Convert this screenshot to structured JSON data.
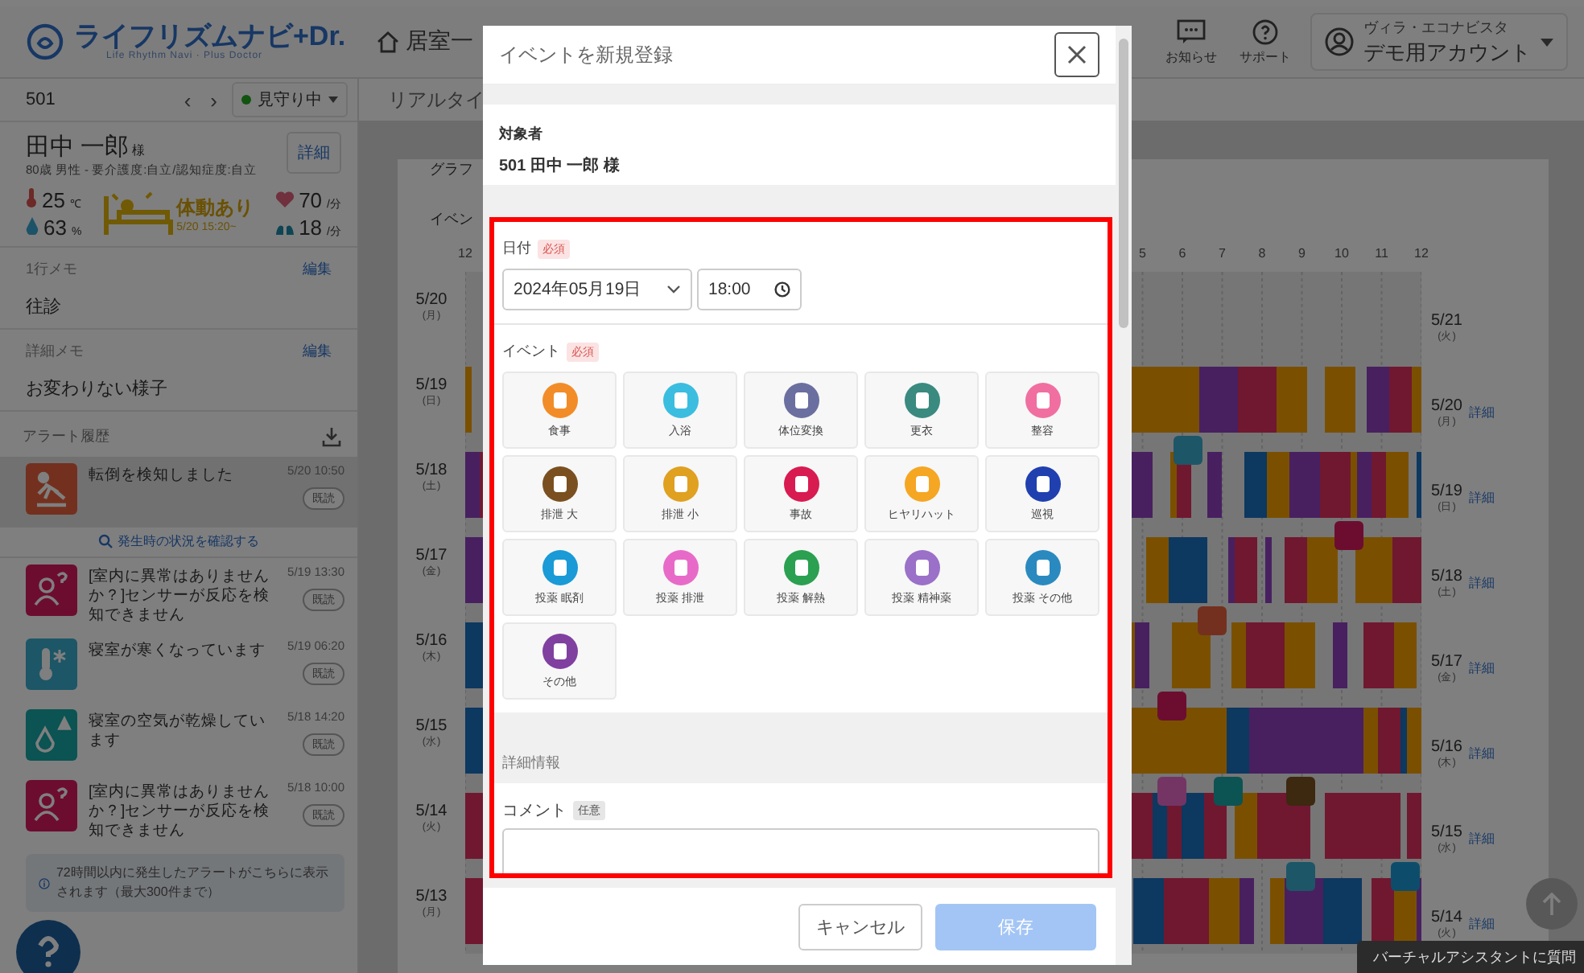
{
  "header": {
    "logo": "ライフリズムナビ+Dr.",
    "tagline": "Life Rhythm Navi · Plus Doctor",
    "nav": "居室一",
    "notifications": "お知らせ",
    "support": "サポート",
    "account": {
      "facility": "ヴィラ・エコナビスタ",
      "name": "デモ用アカウント"
    }
  },
  "resident_bar": {
    "room": "501",
    "prev": "‹",
    "next": "›",
    "status": "見守り中"
  },
  "resident": {
    "name": "田中 一郎",
    "honorific": "様",
    "profile": "80歳 男性 - 要介護度:自立/認知症度:自立",
    "detail_button": "詳細",
    "temperature": "25",
    "temperature_unit": "℃",
    "humidity": "63",
    "humidity_unit": "%",
    "activity": "体動あり",
    "activity_since": "5/20 15:20~",
    "heart_rate": "70",
    "heart_rate_unit": "/分",
    "respiration": "18",
    "respiration_unit": "/分"
  },
  "memos": [
    {
      "label": "1行メモ",
      "edit": "編集",
      "text": "往診"
    },
    {
      "label": "詳細メモ",
      "edit": "編集",
      "text": "お変わりない様子"
    }
  ],
  "alerts": {
    "title": "アラート履歴",
    "items": [
      {
        "kind": "fall",
        "text": "転倒を検知しました",
        "time": "5/20 10:50",
        "read": "既読",
        "selected": true,
        "link": "発生時の状況を確認する"
      },
      {
        "kind": "absence",
        "text": "[室内に異常はありませんか？]センサーが反応を検知できません",
        "time": "5/19 13:30",
        "read": "既読",
        "selected": false
      },
      {
        "kind": "cold",
        "text": "寝室が寒くなっています",
        "time": "5/19 06:20",
        "read": "既読",
        "selected": false
      },
      {
        "kind": "dry",
        "text": "寝室の空気が乾燥しています",
        "time": "5/18 14:20",
        "read": "既読",
        "selected": false
      },
      {
        "kind": "absence",
        "text": "[室内に異常はありませんか？]センサーが反応を検知できません",
        "time": "5/18 10:00",
        "read": "既読",
        "selected": false
      }
    ],
    "info": "72時間以内に発生したアラートがこちらに表示されます（最大300件まで）"
  },
  "main": {
    "tab": "リアルタイ",
    "graph_label": "グラフ",
    "event_label": "イベン",
    "ticks": [
      "12",
      "5",
      "6",
      "7",
      "8",
      "9",
      "10",
      "11",
      "12"
    ],
    "left_dates": [
      {
        "date": "5/20",
        "weekday": "(月)"
      },
      {
        "date": "5/19",
        "weekday": "(日)"
      },
      {
        "date": "5/18",
        "weekday": "(土)"
      },
      {
        "date": "5/17",
        "weekday": "(金)"
      },
      {
        "date": "5/16",
        "weekday": "(木)"
      },
      {
        "date": "5/15",
        "weekday": "(水)"
      },
      {
        "date": "5/14",
        "weekday": "(火)"
      },
      {
        "date": "5/13",
        "weekday": "(月)"
      }
    ],
    "right_dates": [
      {
        "date": "5/21",
        "weekday": "(火)"
      },
      {
        "date": "5/20",
        "weekday": "(月)",
        "detail": "詳細"
      },
      {
        "date": "5/19",
        "weekday": "(日)",
        "detail": "詳細"
      },
      {
        "date": "5/18",
        "weekday": "(土)",
        "detail": "詳細"
      },
      {
        "date": "5/17",
        "weekday": "(金)",
        "detail": "詳細"
      },
      {
        "date": "5/16",
        "weekday": "(木)",
        "detail": "詳細"
      },
      {
        "date": "5/15",
        "weekday": "(水)",
        "detail": "詳細"
      },
      {
        "date": "5/14",
        "weekday": "(火)",
        "detail": "詳細"
      }
    ]
  },
  "modal": {
    "title": "イベントを新規登録",
    "subject_label": "対象者",
    "subject": "501 田中 一郎 様",
    "date_label": "日付",
    "date_required": "必須",
    "date": "2024年05月19日",
    "time": "18:00",
    "event_label": "イベント",
    "event_required": "必須",
    "events": [
      {
        "label": "食事",
        "color": "#f28c28",
        "selected": false
      },
      {
        "label": "入浴",
        "color": "#3bbde0",
        "selected": false
      },
      {
        "label": "体位変換",
        "color": "#6a6fa0",
        "selected": false
      },
      {
        "label": "更衣",
        "color": "#3a8a80",
        "selected": false
      },
      {
        "label": "整容",
        "color": "#f06fa0",
        "selected": false
      },
      {
        "label": "排泄 大",
        "color": "#7a5020",
        "selected": false
      },
      {
        "label": "排泄 小",
        "color": "#e0a020",
        "selected": false
      },
      {
        "label": "事故",
        "color": "#d81b50",
        "selected": false
      },
      {
        "label": "ヒヤリハット",
        "color": "#f5a623",
        "selected": false
      },
      {
        "label": "巡視",
        "color": "#2040b0",
        "selected": false
      },
      {
        "label": "投薬 眠剤",
        "color": "#1a9ad6",
        "selected": false
      },
      {
        "label": "投薬 排泄",
        "color": "#e86ac8",
        "selected": false
      },
      {
        "label": "投薬 解熱",
        "color": "#2aa050",
        "selected": false
      },
      {
        "label": "投薬 精神薬",
        "color": "#9a70c8",
        "selected": false
      },
      {
        "label": "投薬 その他",
        "color": "#2a8ac0",
        "selected": false
      },
      {
        "label": "その他",
        "color": "#8040a0",
        "selected": false
      }
    ],
    "details_heading": "詳細情報",
    "comment_label": "コメント",
    "comment_optional": "任意",
    "cancel": "キャンセル",
    "save": "保存",
    "save_disabled": true
  },
  "assistant": "バーチャルアシスタントに質問"
}
